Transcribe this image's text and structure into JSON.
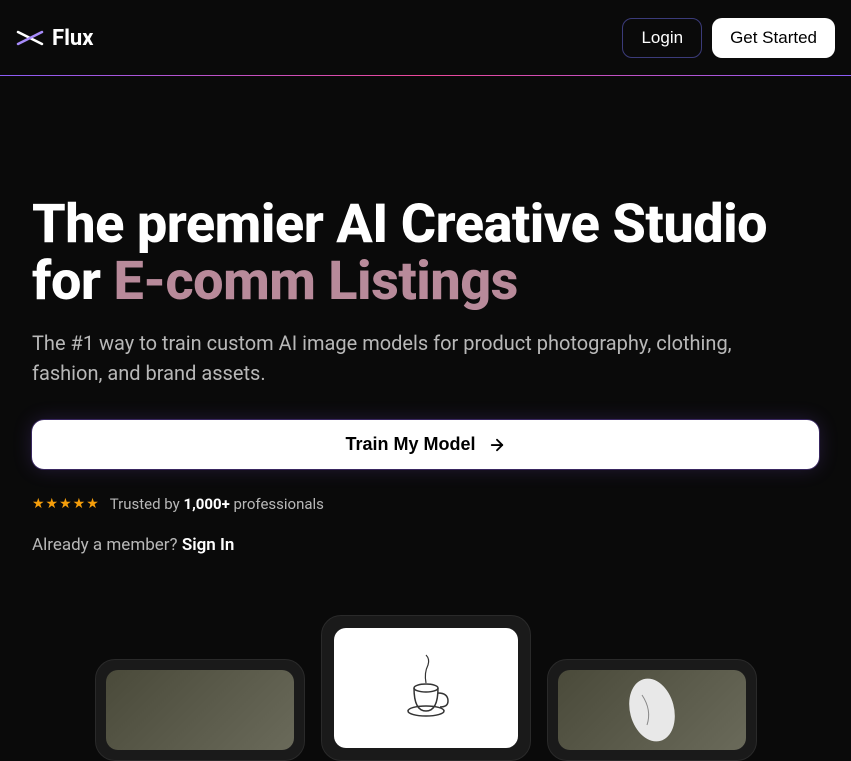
{
  "header": {
    "brand": "Flux",
    "login_label": "Login",
    "getstarted_label": "Get Started"
  },
  "hero": {
    "title_prefix": "The premier AI Creative Studio for ",
    "title_highlight": "E-comm Listings",
    "subtitle": "The #1 way to train custom AI image models for product photography, clothing, fashion, and brand assets.",
    "cta_label": "Train My Model"
  },
  "trust": {
    "stars": "★★★★★",
    "text_prefix": "Trusted by ",
    "count": "1,000+",
    "text_suffix": " professionals"
  },
  "member": {
    "prompt": "Already a member? ",
    "signin_label": "Sign In"
  }
}
